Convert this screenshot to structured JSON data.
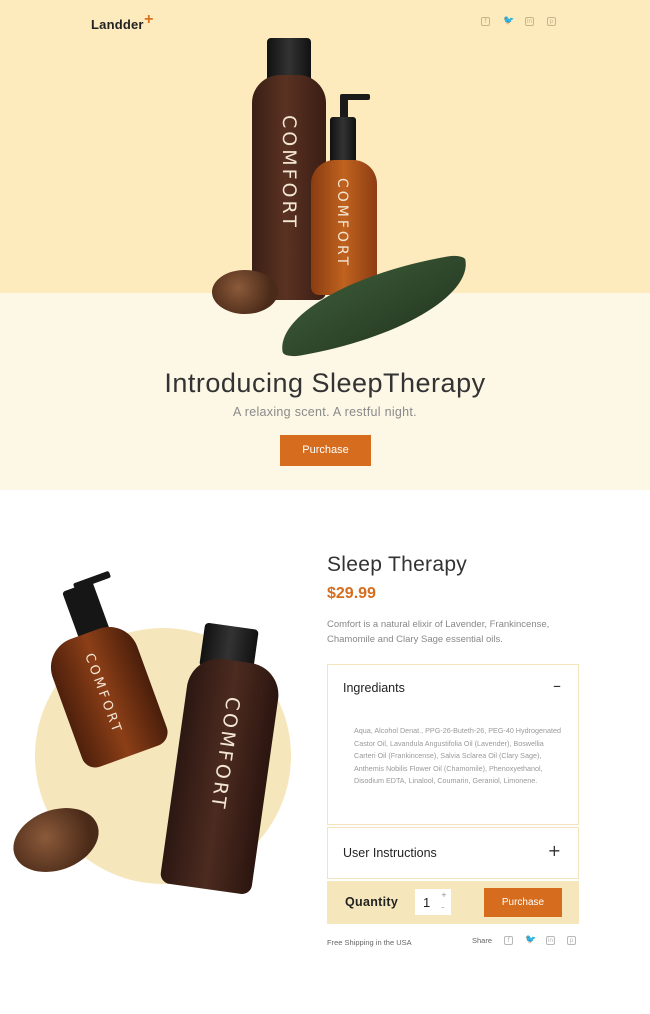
{
  "brand": {
    "name": "Landder",
    "plus": "+"
  },
  "social_icons": [
    "facebook-icon",
    "twitter-icon",
    "linkedin-icon",
    "pinterest-icon"
  ],
  "hero": {
    "bottle_label": "COMFORT",
    "title": "Introducing SleepTherapy",
    "subtitle": "A relaxing scent. A restful night.",
    "button": "Purchase"
  },
  "product": {
    "bottle_label": "COMFORT",
    "title": "Sleep Therapy",
    "price": "$29.99",
    "description": "Comfort is a natural elixir of Lavender, Frankincense, Chamomile and Clary Sage essential oils.",
    "accordion": [
      {
        "title": "Ingrediants",
        "toggle": "–",
        "body": "Aqua, Alcohol Denat., PPG-26-Buteth-26, PEG-40 Hydrogenated Castor Oil, Lavandula Angustifolia Oil (Lavender), Boswellia Carteri Oil (Frankincense), Salvia Sclarea Oil (Clary Sage), Anthemis Nobilis Flower Oil (Chamomile), Phenoxyethanol, Disodium EDTA, Linalool, Coumarin, Geraniol, Limonene."
      },
      {
        "title": "User Instructions",
        "toggle": "+"
      }
    ],
    "quantity": {
      "label": "Quantity",
      "value": "1",
      "up": "+",
      "down": "–"
    },
    "button": "Purchase",
    "shipping": "Free Shipping in the USA",
    "share_label": "Share"
  },
  "colors": {
    "accent": "#d66d1e",
    "hero_top": "#fdebbd",
    "hero_bottom": "#fdf7e6",
    "cream": "#f6e6bb"
  }
}
